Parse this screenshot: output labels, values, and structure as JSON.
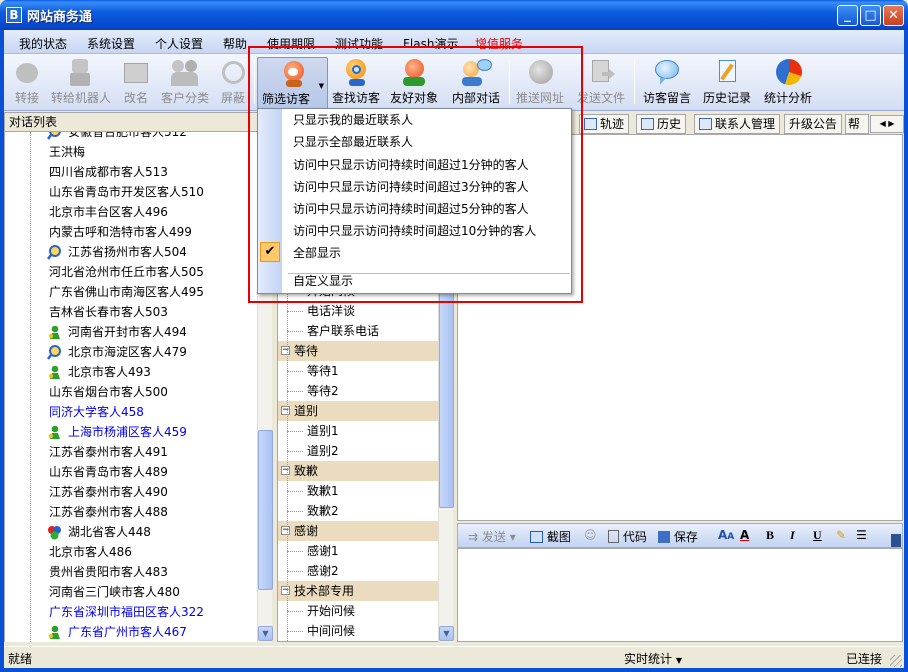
{
  "window": {
    "title": "网站商务通",
    "icon_letter": "B"
  },
  "menu": [
    "我的状态",
    "系统设置",
    "个人设置",
    "帮助",
    "使用期限",
    "测试功能",
    "Flash演示",
    "增值服务"
  ],
  "toolbar": [
    {
      "label": "转接",
      "state": "disabled"
    },
    {
      "label": "转给机器人",
      "state": "disabled"
    },
    {
      "label": "改名",
      "state": "disabled"
    },
    {
      "label": "客户分类",
      "state": "disabled"
    },
    {
      "label": "屏蔽",
      "state": "disabled"
    },
    {
      "label": "筛选访客",
      "state": "pressed"
    },
    {
      "label": "查找访客",
      "state": "enabled"
    },
    {
      "label": "友好对象",
      "state": "enabled"
    },
    {
      "label": "内部对话",
      "state": "enabled"
    },
    {
      "label": "推送网址",
      "state": "disabled"
    },
    {
      "label": "发送文件",
      "state": "disabled"
    },
    {
      "label": "访客留言",
      "state": "enabled"
    },
    {
      "label": "历史记录",
      "state": "enabled"
    },
    {
      "label": "统计分析",
      "state": "enabled"
    }
  ],
  "left_pane": {
    "title": "对话列表",
    "rows": [
      {
        "text": "安徽省合肥市客人512",
        "icon": "magnifier",
        "blue": false
      },
      {
        "text": "王洪梅",
        "icon": "",
        "blue": false
      },
      {
        "text": "四川省成都市客人513",
        "icon": "",
        "blue": false
      },
      {
        "text": "山东省青岛市开发区客人510",
        "icon": "",
        "blue": false
      },
      {
        "text": "北京市丰台区客人496",
        "icon": "",
        "blue": false
      },
      {
        "text": "内蒙古呼和浩特市客人499",
        "icon": "",
        "blue": false
      },
      {
        "text": "江苏省扬州市客人504",
        "icon": "magnifier",
        "blue": false
      },
      {
        "text": "河北省沧州市任丘市客人505",
        "icon": "",
        "blue": false
      },
      {
        "text": "广东省佛山市南海区客人495",
        "icon": "",
        "blue": false
      },
      {
        "text": "吉林省长春市客人503",
        "icon": "",
        "blue": false
      },
      {
        "text": "河南省开封市客人494",
        "icon": "person",
        "blue": false
      },
      {
        "text": "北京市海淀区客人479",
        "icon": "magnifier",
        "blue": false
      },
      {
        "text": "北京市客人493",
        "icon": "person",
        "blue": false
      },
      {
        "text": "山东省烟台市客人500",
        "icon": "",
        "blue": false
      },
      {
        "text": "同济大学客人458",
        "icon": "",
        "blue": true
      },
      {
        "text": "上海市杨浦区客人459",
        "icon": "person",
        "blue": true
      },
      {
        "text": "江苏省泰州市客人491",
        "icon": "",
        "blue": false
      },
      {
        "text": "山东省青岛市客人489",
        "icon": "",
        "blue": false
      },
      {
        "text": "江苏省泰州市客人490",
        "icon": "",
        "blue": false
      },
      {
        "text": "江苏省泰州市客人488",
        "icon": "",
        "blue": false
      },
      {
        "text": "湖北省客人448",
        "icon": "balls",
        "blue": false
      },
      {
        "text": "北京市客人486",
        "icon": "",
        "blue": false
      },
      {
        "text": "贵州省贵阳市客人483",
        "icon": "",
        "blue": false
      },
      {
        "text": "河南省三门峡市客人480",
        "icon": "",
        "blue": false
      },
      {
        "text": "广东省深圳市福田区客人322",
        "icon": "",
        "blue": true
      },
      {
        "text": "广东省广州市客人467",
        "icon": "person",
        "blue": true
      }
    ]
  },
  "middle_tree": {
    "items": [
      {
        "type": "leaf",
        "text": "开始问候"
      },
      {
        "type": "leaf",
        "text": "电话洋谈"
      },
      {
        "type": "leaf",
        "text": "客户联系电话"
      },
      {
        "type": "cat",
        "text": "等待"
      },
      {
        "type": "leaf",
        "text": "等待1"
      },
      {
        "type": "leaf",
        "text": "等待2"
      },
      {
        "type": "cat",
        "text": "道别"
      },
      {
        "type": "leaf",
        "text": "道别1"
      },
      {
        "type": "leaf",
        "text": "道别2"
      },
      {
        "type": "cat",
        "text": "致歉"
      },
      {
        "type": "leaf",
        "text": "致歉1"
      },
      {
        "type": "leaf",
        "text": "致歉2"
      },
      {
        "type": "cat",
        "text": "感谢"
      },
      {
        "type": "leaf",
        "text": "感谢1"
      },
      {
        "type": "leaf",
        "text": "感谢2"
      },
      {
        "type": "cat",
        "text": "技术部专用"
      },
      {
        "type": "leaf",
        "text": "开始问候"
      },
      {
        "type": "leaf",
        "text": "中间问候"
      }
    ]
  },
  "right_tabs": [
    "轨迹",
    "历史",
    "联系人管理",
    "升级公告",
    "帮"
  ],
  "edit_bar": {
    "send": "发送",
    "screenshot": "截图",
    "code": "代码",
    "save": "保存",
    "bold": "B",
    "italic": "I",
    "underline": "U"
  },
  "dropdown": {
    "items": [
      "只显示我的最近联系人",
      "只显示全部最近联系人",
      "访问中只显示访问持续时间超过1分钟的客人",
      "访问中只显示访问持续时间超过3分钟的客人",
      "访问中只显示访问持续时间超过5分钟的客人",
      "访问中只显示访问持续时间超过10分钟的客人",
      "全部显示",
      "自定义显示"
    ],
    "checked_index": 6
  },
  "status": {
    "left": "就绪",
    "middle": "实时统计",
    "right": "已连接"
  },
  "colors": {
    "accent_red": "#e60000",
    "title_blue": "#0a5fe4",
    "link_blue": "#0000ee",
    "category_bg": "#ebdcc0"
  }
}
